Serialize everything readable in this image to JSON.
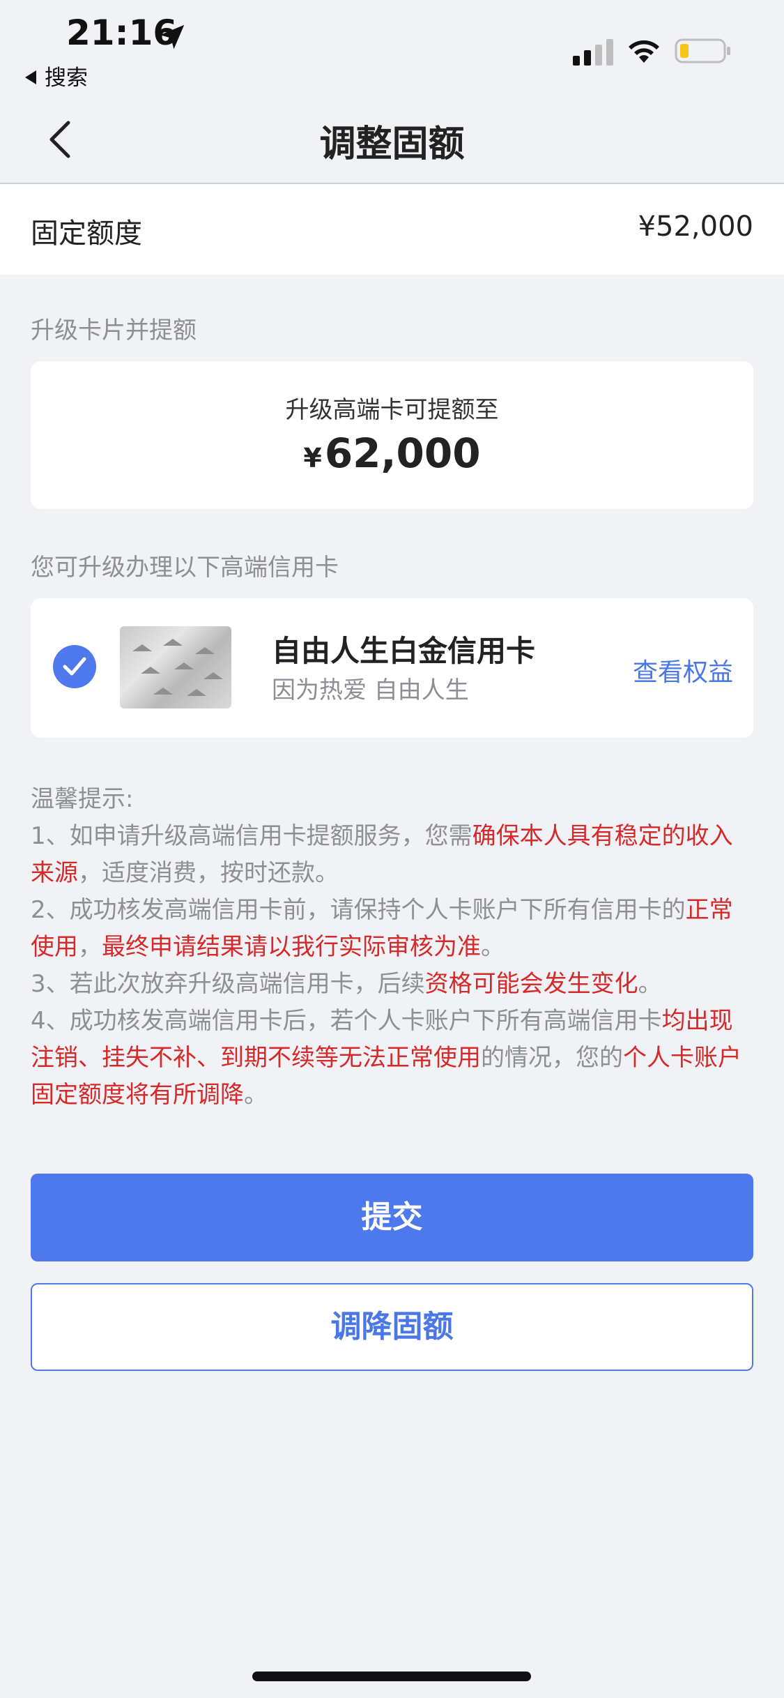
{
  "status_bar": {
    "time": "21:16",
    "back_app_label": "搜索",
    "icons": [
      "location-arrow-icon",
      "signal-icon",
      "wifi-icon",
      "battery-icon"
    ]
  },
  "nav": {
    "title": "调整固额",
    "back_icon": "chevron-left-icon"
  },
  "fixed_limit": {
    "label": "固定额度",
    "value": "¥52,000"
  },
  "upgrade_section": {
    "title": "升级卡片并提额",
    "line": "升级高端卡可提额至",
    "currency": "¥",
    "amount": "62,000"
  },
  "card_section": {
    "title": "您可升级办理以下高端信用卡",
    "card_name": "自由人生白金信用卡",
    "card_slogan": "因为热爱 自由人生",
    "link_label": "查看权益",
    "selected": true
  },
  "tips": {
    "title": "温馨提示:",
    "t1a": "1、如申请升级高端信用卡提额服务，您需",
    "t1b": "确保本人具有稳定的收入来源",
    "t1c": "，适度消费，按时还款。",
    "t2a": "2、成功核发高端信用卡前，请保持个人卡账户下所有信用卡的",
    "t2b": "正常使用",
    "t2c": "，",
    "t2d": "最终申请结果请以我行实际审核为准",
    "t2e": "。",
    "t3a": "3、若此次放弃升级高端信用卡，后续",
    "t3b": "资格可能会发生变化",
    "t3c": "。",
    "t4a": "4、成功核发高端信用卡后，若个人卡账户下所有高端信用卡",
    "t4b": "均出现注销、挂失不补、到期不续等无法正常使用",
    "t4c": "的情况，您的",
    "t4d": "个人卡账户固定额度将有所调降",
    "t4e": "。"
  },
  "buttons": {
    "submit": "提交",
    "lower": "调降固额"
  },
  "colors": {
    "accent": "#4e79ec",
    "warning_red": "#d42a2a",
    "background": "#f1f2f5"
  }
}
